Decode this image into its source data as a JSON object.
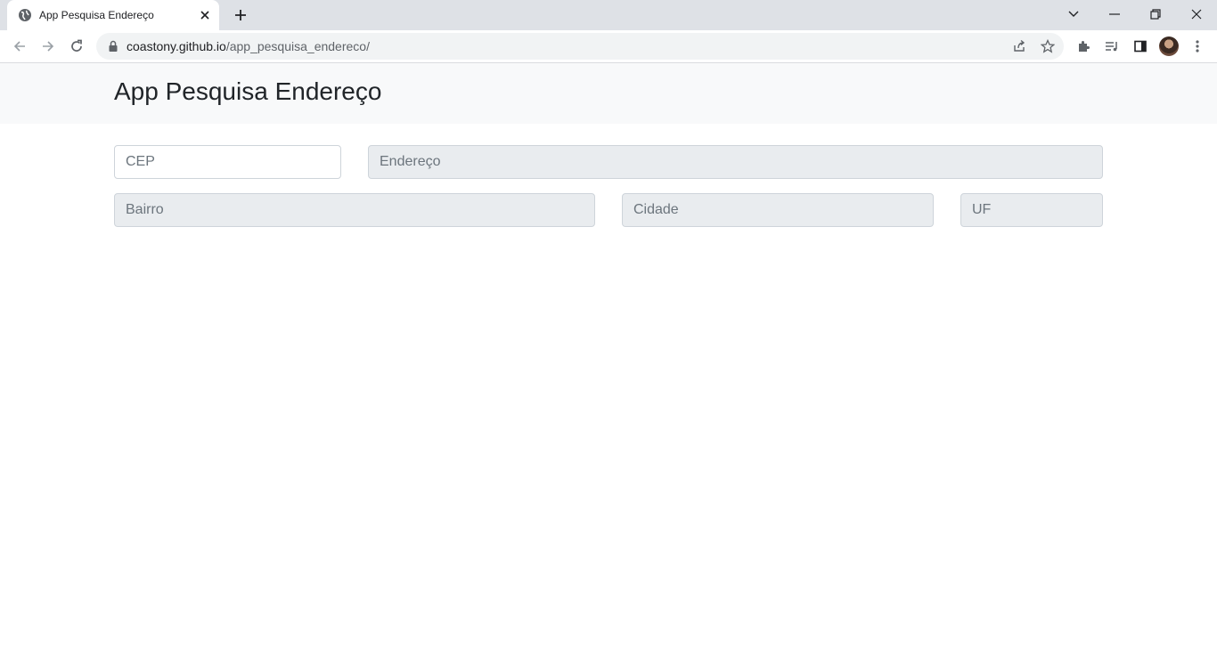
{
  "browser": {
    "tab": {
      "title": "App Pesquisa Endereço"
    },
    "url": {
      "host": "coastony.github.io",
      "path": "/app_pesquisa_endereco/"
    }
  },
  "page": {
    "title": "App Pesquisa Endereço",
    "fields": {
      "cep": {
        "placeholder": "CEP",
        "value": ""
      },
      "endereco": {
        "placeholder": "Endereço",
        "value": ""
      },
      "bairro": {
        "placeholder": "Bairro",
        "value": ""
      },
      "cidade": {
        "placeholder": "Cidade",
        "value": ""
      },
      "uf": {
        "placeholder": "UF",
        "value": ""
      }
    }
  },
  "colors": {
    "navbar_bg": "#f8f9fa",
    "readonly_bg": "#e9ecef",
    "border": "#ced4da"
  }
}
